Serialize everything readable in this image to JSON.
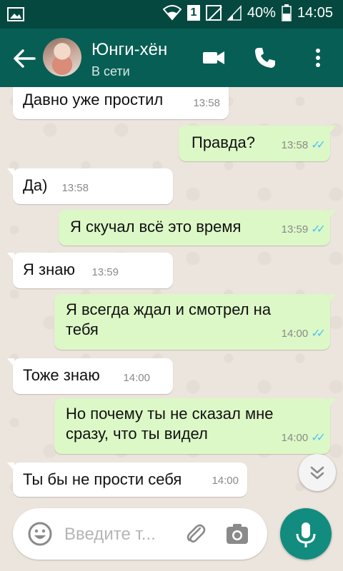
{
  "statusbar": {
    "battery": "40%",
    "time": "14:05",
    "sim": "1"
  },
  "header": {
    "name": "Юнги-хён",
    "status": "В сети"
  },
  "messages": [
    {
      "dir": "in",
      "text": "Давно уже простил",
      "time": "13:58"
    },
    {
      "dir": "out",
      "text": "Правда?",
      "time": "13:58"
    },
    {
      "dir": "in",
      "text": "Да)",
      "time": "13:58"
    },
    {
      "dir": "out",
      "text": "Я скучал всё это время",
      "time": "13:59"
    },
    {
      "dir": "in",
      "text": "Я знаю",
      "time": "13:59"
    },
    {
      "dir": "out",
      "text": "Я всегда ждал и смотрел на тебя",
      "time": "14:00"
    },
    {
      "dir": "in",
      "text": "Тоже знаю",
      "time": "14:00"
    },
    {
      "dir": "out",
      "text": "Но почему ты не сказал мне сразу, что ты видел",
      "time": "14:00"
    },
    {
      "dir": "in",
      "text": "Ты бы не прости себя",
      "time": "14:00"
    }
  ],
  "composer": {
    "placeholder": "Введите т..."
  },
  "colors": {
    "header": "#075e54",
    "statusbar": "#05483f",
    "outgoing_bubble": "#dcf8c6",
    "incoming_bubble": "#ffffff",
    "read_ticks": "#4fc3f7",
    "mic_button": "#128c7e"
  },
  "icons": [
    "image-icon",
    "wifi-icon",
    "sim-icon",
    "no-signal-icon",
    "signal-icon",
    "battery-icon",
    "back-arrow-icon",
    "video-call-icon",
    "phone-icon",
    "more-vert-icon",
    "double-check-icon",
    "chevron-down-icon",
    "emoji-icon",
    "attach-icon",
    "camera-icon",
    "mic-icon"
  ]
}
